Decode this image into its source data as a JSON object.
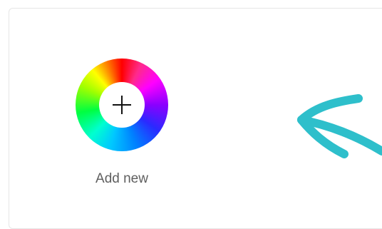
{
  "add_new": {
    "label": "Add new",
    "icon": "plus-icon"
  },
  "colors": {
    "arrow": "#2ebfcb",
    "panel_border": "#e6e6e6",
    "label_text": "#5f5f5f"
  }
}
